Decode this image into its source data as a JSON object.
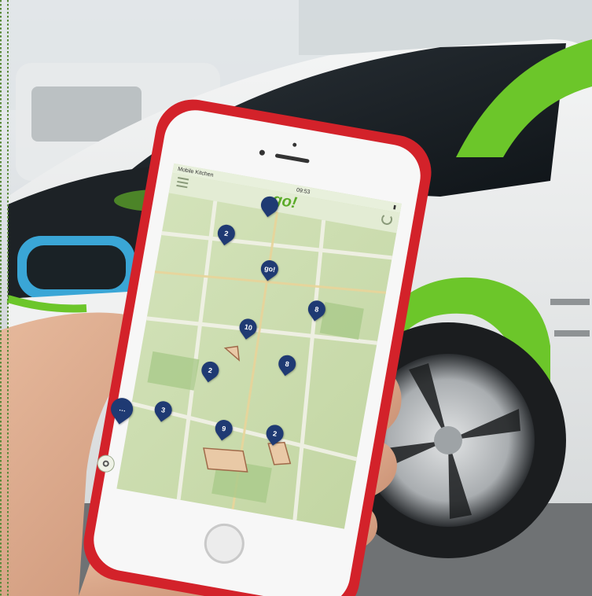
{
  "photo": {
    "subject": "hand holding smartphone with car-sharing map app in front of electric car"
  },
  "app": {
    "logo_text": "go!",
    "status_carrier": "Mobile Kitchen",
    "status_time": "09:53",
    "status_battery": "▮"
  },
  "map": {
    "pins": [
      {
        "label": "",
        "kind": "single"
      },
      {
        "label": "2",
        "kind": "count"
      },
      {
        "label": "go!",
        "kind": "brand"
      },
      {
        "label": "8",
        "kind": "count"
      },
      {
        "label": "10",
        "kind": "count"
      },
      {
        "label": "8",
        "kind": "count"
      },
      {
        "label": "2",
        "kind": "count"
      },
      {
        "label": "3",
        "kind": "count"
      },
      {
        "label": "9",
        "kind": "count"
      },
      {
        "label": "2",
        "kind": "count"
      },
      {
        "label": "…",
        "kind": "more"
      }
    ]
  },
  "colors": {
    "car_green": "#6cc62a",
    "phone_case": "#d3222a",
    "pin_blue": "#1f3a73",
    "map_green": "#c9dcae"
  },
  "icons": {
    "locate": "crosshair-icon",
    "menu": "hamburger-icon",
    "refresh": "refresh-icon"
  }
}
